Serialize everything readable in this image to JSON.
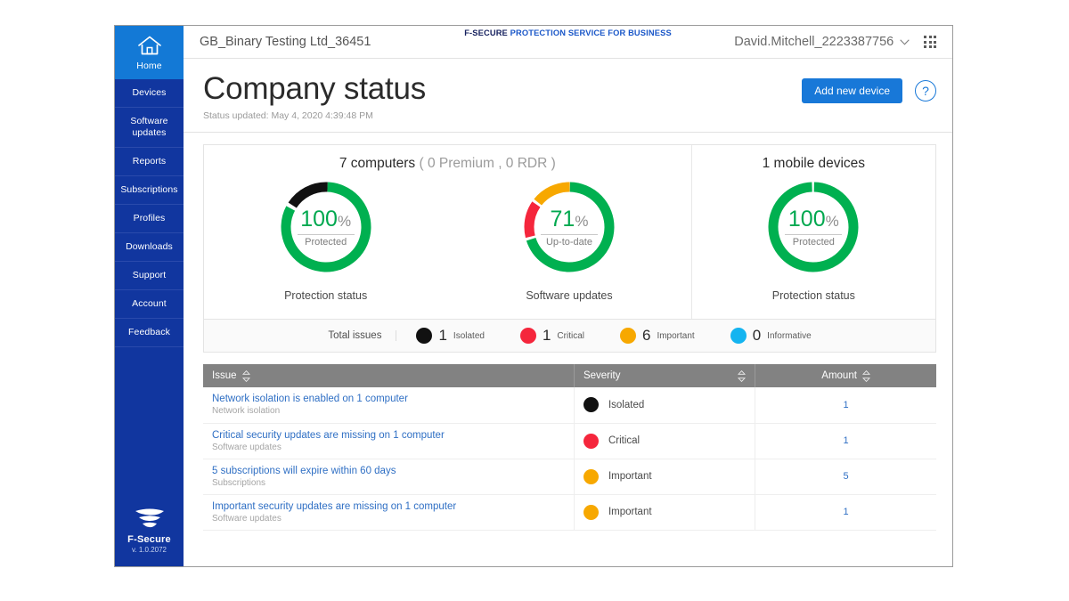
{
  "sidebar": {
    "items": [
      {
        "label": "Home",
        "icon": "home-icon",
        "active": true
      },
      {
        "label": "Devices",
        "active": false
      },
      {
        "label": "Software updates",
        "active": false
      },
      {
        "label": "Reports",
        "active": false
      },
      {
        "label": "Subscriptions",
        "active": false
      },
      {
        "label": "Profiles",
        "active": false
      },
      {
        "label": "Downloads",
        "active": false
      },
      {
        "label": "Support",
        "active": false
      },
      {
        "label": "Account",
        "active": false
      },
      {
        "label": "Feedback",
        "active": false
      }
    ],
    "brand_name": "F-Secure",
    "brand_version": "v. 1.0.2072"
  },
  "topbar": {
    "org_name": "GB_Binary Testing Ltd_36451",
    "product_brand_primary": "F-SECURE",
    "product_brand_secondary": "PROTECTION SERVICE FOR BUSINESS",
    "user_name": "David.Mitchell_2223387756",
    "chevron_icon": "chevron-down-icon",
    "apps_icon": "apps-grid-icon"
  },
  "page": {
    "title": "Company status",
    "status_updated": "Status updated: May 4, 2020 4:39:48 PM",
    "add_device_label": "Add new device",
    "help_label": "?"
  },
  "computers_panel": {
    "heading_main": "7 computers",
    "heading_muted": "( 0 Premium , 0 RDR )",
    "donuts": [
      {
        "value": "100",
        "pct": "%",
        "sub": "Protected",
        "caption": "Protection status"
      },
      {
        "value": "71",
        "pct": "%",
        "sub": "Up-to-date",
        "caption": "Software updates"
      }
    ]
  },
  "mobile_panel": {
    "heading_main": "1 mobile devices",
    "donut": {
      "value": "100",
      "pct": "%",
      "sub": "Protected",
      "caption": "Protection status"
    }
  },
  "issues_legend": {
    "label": "Total issues",
    "items": [
      {
        "count": "1",
        "name": "Isolated",
        "color": "#111111"
      },
      {
        "count": "1",
        "name": "Critical",
        "color": "#f5263c"
      },
      {
        "count": "6",
        "name": "Important",
        "color": "#f7a800"
      },
      {
        "count": "0",
        "name": "Informative",
        "color": "#14b4f0"
      }
    ]
  },
  "issues_table": {
    "columns": [
      "Issue",
      "Severity",
      "Amount"
    ],
    "rows": [
      {
        "title": "Network isolation is enabled on 1 computer",
        "category": "Network isolation",
        "severity": "Isolated",
        "severity_color": "#111111",
        "amount": "1"
      },
      {
        "title": "Critical security updates are missing on 1 computer",
        "category": "Software updates",
        "severity": "Critical",
        "severity_color": "#f5263c",
        "amount": "1"
      },
      {
        "title": "5 subscriptions will expire within 60 days",
        "category": "Subscriptions",
        "severity": "Important",
        "severity_color": "#f7a800",
        "amount": "5"
      },
      {
        "title": "Important security updates are missing on 1 computer",
        "category": "Software updates",
        "severity": "Important",
        "severity_color": "#f7a800",
        "amount": "1"
      }
    ]
  },
  "chart_data": [
    {
      "type": "pie",
      "title": "Protection status",
      "subtitle": "7 computers",
      "center_value": 100,
      "center_unit": "%",
      "center_label": "Protected",
      "categories": [
        "Protected",
        "Isolated"
      ],
      "values": [
        82,
        18
      ],
      "colors": [
        "#00b050",
        "#111111"
      ],
      "legend": "none"
    },
    {
      "type": "pie",
      "title": "Software updates",
      "subtitle": "7 computers",
      "center_value": 71,
      "center_unit": "%",
      "center_label": "Up-to-date",
      "categories": [
        "Up-to-date",
        "Critical",
        "Important"
      ],
      "values": [
        71,
        14,
        15
      ],
      "colors": [
        "#00b050",
        "#f5263c",
        "#f7a800"
      ],
      "legend": "none"
    },
    {
      "type": "pie",
      "title": "Protection status",
      "subtitle": "1 mobile devices",
      "center_value": 100,
      "center_unit": "%",
      "center_label": "Protected",
      "categories": [
        "Protected"
      ],
      "values": [
        100
      ],
      "colors": [
        "#00b050"
      ],
      "legend": "none"
    }
  ]
}
